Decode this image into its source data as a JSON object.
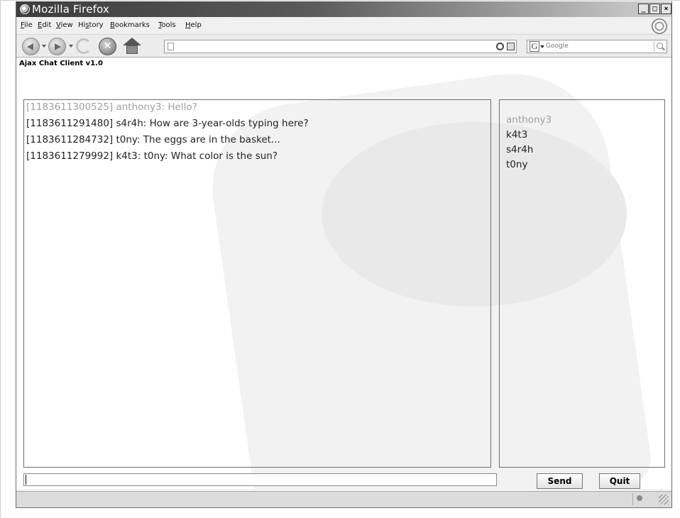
{
  "window": {
    "title": "Mozilla Firefox",
    "min_glyph": "_",
    "max_glyph": "□",
    "close_glyph": "×"
  },
  "menu": {
    "items": [
      {
        "key": "F",
        "rest": "ile"
      },
      {
        "key": "E",
        "rest": "dit"
      },
      {
        "key": "V",
        "rest": "iew"
      },
      {
        "pre": "Hi",
        "key": "s",
        "rest": "tory"
      },
      {
        "key": "B",
        "rest": "ookmarks"
      },
      {
        "key": "T",
        "rest": "ools"
      },
      {
        "key": "H",
        "rest": "elp"
      }
    ]
  },
  "navbar": {
    "url": "",
    "search_placeholder": "Google",
    "search_engine_glyph": "G",
    "stop_glyph": "✕"
  },
  "app": {
    "title": "Ajax Chat Client v1.0",
    "messages": [
      {
        "text": "[1183611300525] anthony3: Hello?",
        "muted": true
      },
      {
        "text": "[1183611291480] s4r4h: How are 3-year-olds typing here?",
        "muted": false
      },
      {
        "text": "[1183611284732] t0ny: The eggs are in the basket...",
        "muted": false
      },
      {
        "text": "[1183611279992] k4t3: t0ny: What color is the sun?",
        "muted": false
      }
    ],
    "users": [
      {
        "name": "anthony3",
        "muted": true
      },
      {
        "name": "k4t3",
        "muted": false
      },
      {
        "name": "s4r4h",
        "muted": false
      },
      {
        "name": "t0ny",
        "muted": false
      }
    ],
    "input_value": "",
    "send_label": "Send",
    "quit_label": "Quit"
  }
}
